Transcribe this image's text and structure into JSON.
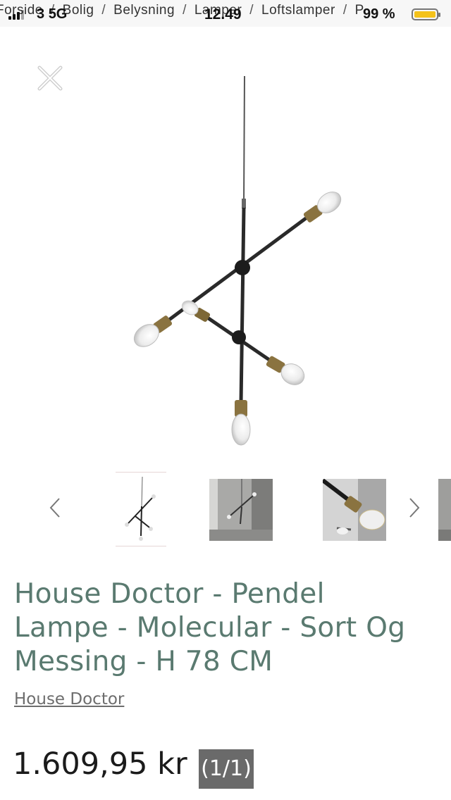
{
  "breadcrumb": [
    "Forside",
    "Bolig",
    "Belysning",
    "Lamper",
    "Loftslamper",
    "P"
  ],
  "status_bar": {
    "carrier": "3",
    "network": "5G",
    "time": "12.49",
    "battery": "99 %"
  },
  "close_icon": "close-icon",
  "gallery": {
    "prev_icon": "chevron-left-icon",
    "next_icon": "chevron-right-icon",
    "thumbnail_count": 4,
    "active_index": 0
  },
  "product": {
    "title_lines": [
      "House Doctor - Pendel",
      "Lampe - Molecular - Sort Og",
      "Messing - H 78 CM"
    ],
    "brand": "House Doctor",
    "price": "1.609,95 kr"
  },
  "image_counter": "(1/1)",
  "colors": {
    "title": "#5a7a70",
    "counter_bg": "#6a6a6a",
    "battery": "#f4c21a"
  }
}
